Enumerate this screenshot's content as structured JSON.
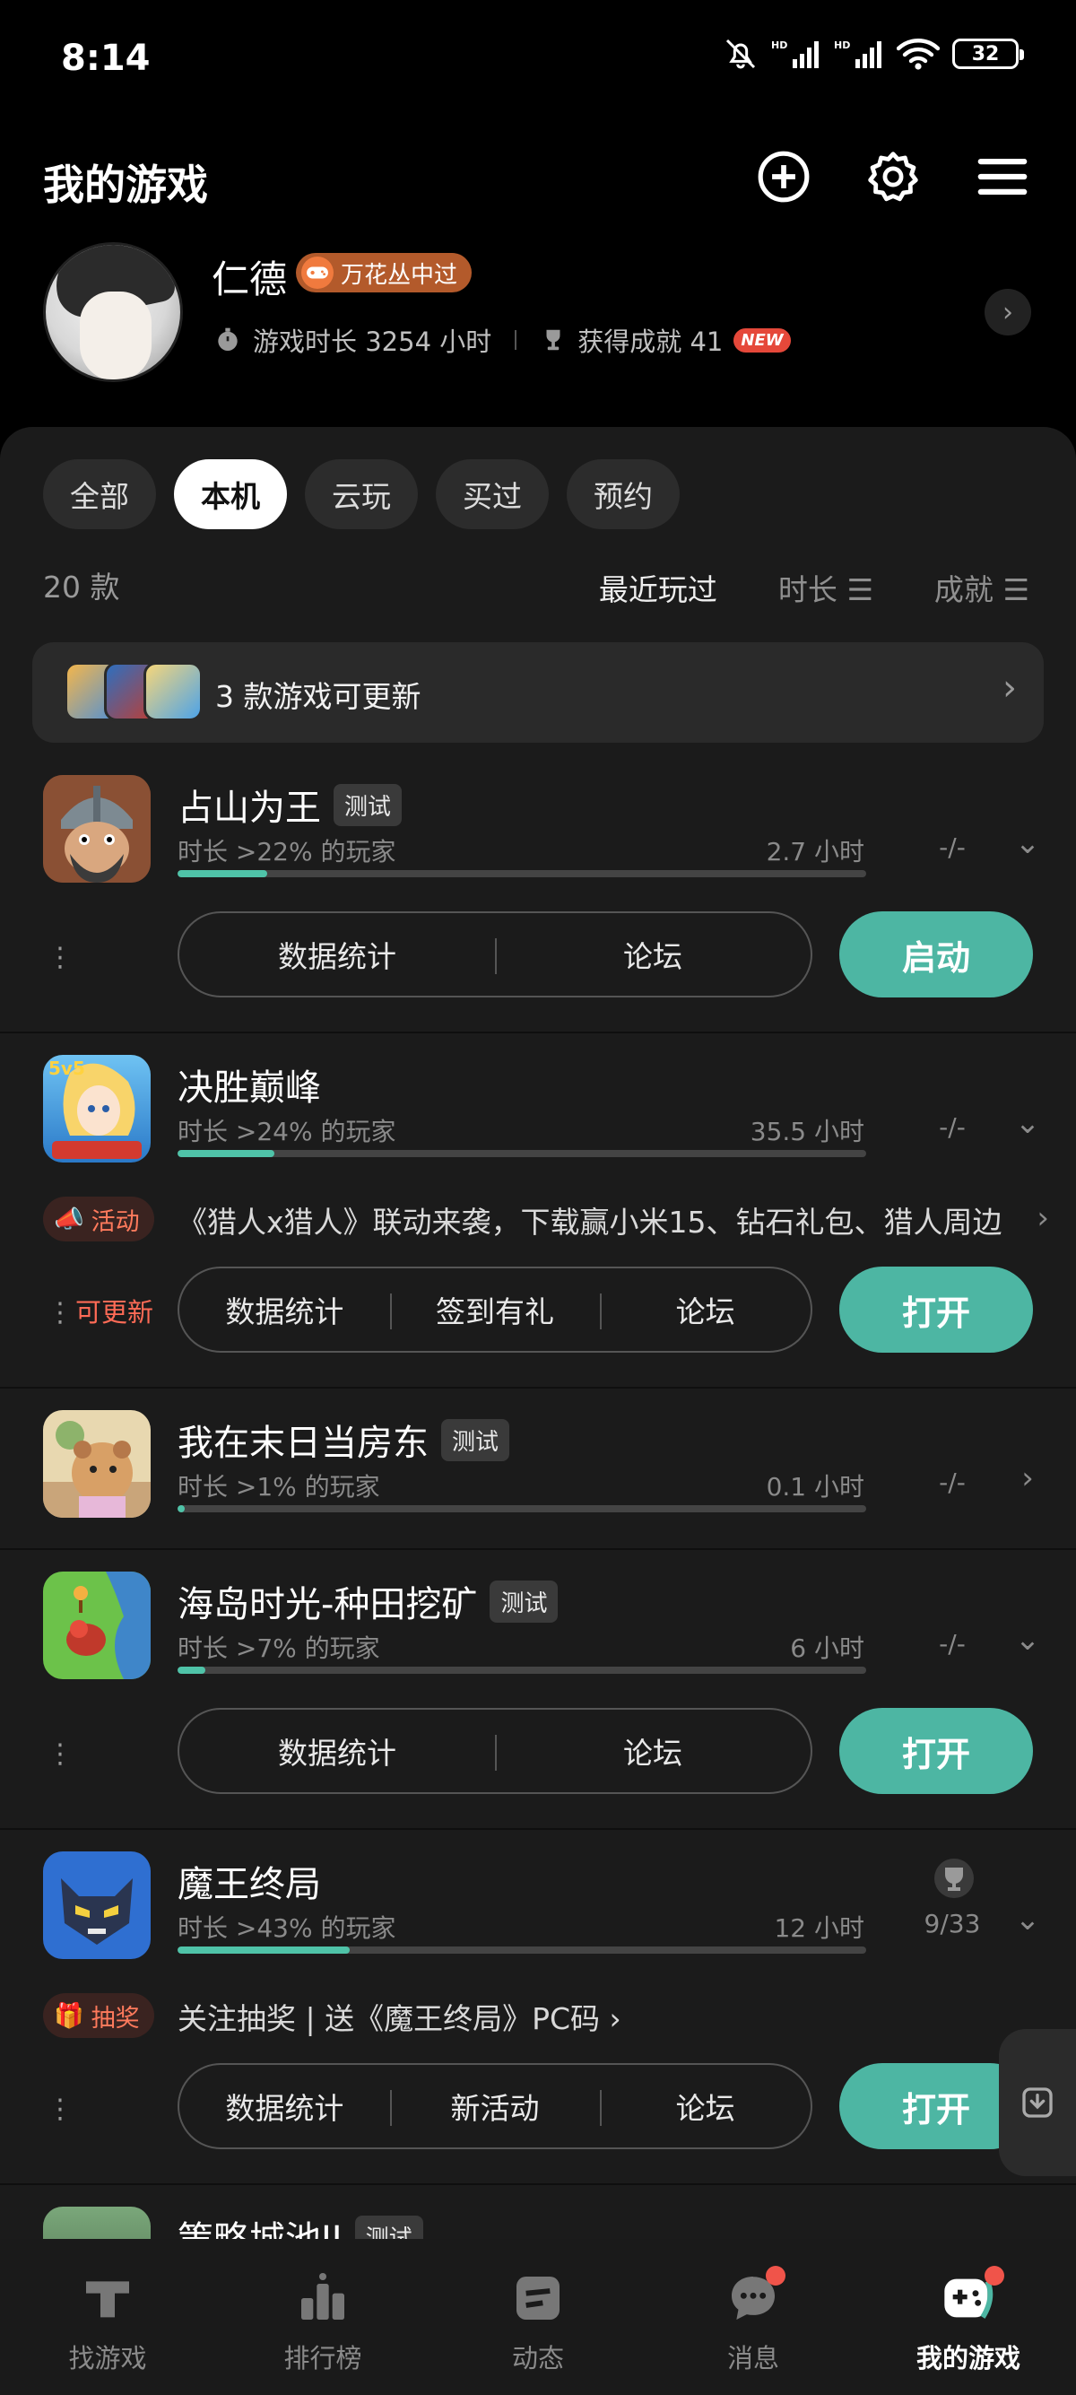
{
  "status_bar": {
    "time": "8:14",
    "battery": "32"
  },
  "header": {
    "title": "我的游戏"
  },
  "profile": {
    "name": "仁德",
    "honor_badge": "万花丛中过",
    "playtime_label": "游戏时长 3254 小时",
    "achievements_label": "获得成就 41",
    "new_badge": "NEW"
  },
  "filters": {
    "tabs": [
      "全部",
      "本机",
      "云玩",
      "买过",
      "预约"
    ],
    "active": "本机",
    "count": "20 款",
    "sorts": [
      "最近玩过",
      "时长",
      "成就"
    ]
  },
  "update_banner": {
    "text": "3 款游戏可更新"
  },
  "games": [
    {
      "name": "占山为王",
      "tag": "测试",
      "percentile": "时长 >22% 的玩家",
      "hours": "2.7 小时",
      "progress": 0.13,
      "achievements": "-/-",
      "actions": [
        "数据统计",
        "论坛"
      ],
      "button": "启动"
    },
    {
      "name": "决胜巅峰",
      "percentile": "时长 >24% 的玩家",
      "hours": "35.5 小时",
      "progress": 0.14,
      "achievements": "-/-",
      "promo_tag": "活动",
      "promo_text": "《猎人x猎人》联动来袭，下载赢小米15、钻石礼包、猎人周边",
      "update_flag": "可更新",
      "actions": [
        "数据统计",
        "签到有礼",
        "论坛"
      ],
      "button": "打开"
    },
    {
      "name": "我在末日当房东",
      "tag": "测试",
      "percentile": "时长 >1% 的玩家",
      "hours": "0.1 小时",
      "progress": 0.01,
      "achievements": "-/-"
    },
    {
      "name": "海岛时光-种田挖矿",
      "tag": "测试",
      "percentile": "时长 >7% 的玩家",
      "hours": "6 小时",
      "progress": 0.04,
      "achievements": "-/-",
      "actions": [
        "数据统计",
        "论坛"
      ],
      "button": "打开"
    },
    {
      "name": "魔王终局",
      "percentile": "时长 >43% 的玩家",
      "hours": "12 小时",
      "progress": 0.25,
      "achievements": "9/33",
      "promo_tag": "抽奖",
      "promo_text": "关注抽奖 | 送《魔王终局》PC码 ›",
      "actions": [
        "数据统计",
        "新活动",
        "论坛"
      ],
      "button": "打开"
    },
    {
      "name": "策略城池II",
      "tag": "测试"
    }
  ],
  "bottom_nav": [
    "找游戏",
    "排行榜",
    "动态",
    "消息",
    "我的游戏"
  ],
  "colors": {
    "accent": "#4db6a3",
    "progress": "#4fc3a8",
    "alert": "#ff6b56"
  }
}
